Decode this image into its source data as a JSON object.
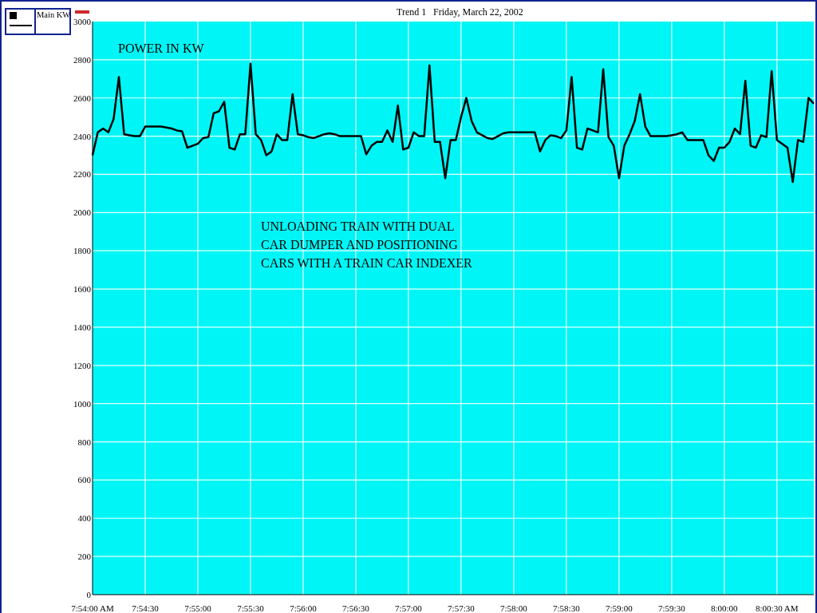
{
  "header": {
    "title": "Trend 1",
    "date": "Friday, March 22, 2002"
  },
  "chart": {
    "chart_data": {
      "type": "line",
      "grid": true,
      "ylim": [
        0,
        3000
      ],
      "yticks": [
        0,
        200,
        400,
        600,
        800,
        1000,
        1200,
        1400,
        1600,
        1800,
        2000,
        2200,
        2400,
        2600,
        2800,
        3000
      ],
      "categories": [
        "7:54:00 AM",
        null,
        null,
        null,
        null,
        null,
        null,
        null,
        null,
        null,
        "7:54:30",
        null,
        null,
        null,
        null,
        null,
        null,
        null,
        null,
        null,
        "7:55:00",
        null,
        null,
        null,
        null,
        null,
        null,
        null,
        null,
        null,
        "7:55:30",
        null,
        null,
        null,
        null,
        null,
        null,
        null,
        null,
        null,
        "7:56:00",
        null,
        null,
        null,
        null,
        null,
        null,
        null,
        null,
        null,
        "7:56:30",
        null,
        null,
        null,
        null,
        null,
        null,
        null,
        null,
        null,
        "7:57:00",
        null,
        null,
        null,
        null,
        null,
        null,
        null,
        null,
        null,
        "7:57:30",
        null,
        null,
        null,
        null,
        null,
        null,
        null,
        null,
        null,
        "7:58:00",
        null,
        null,
        null,
        null,
        null,
        null,
        null,
        null,
        null,
        "7:58:30",
        null,
        null,
        null,
        null,
        null,
        null,
        null,
        null,
        null,
        "7:59:00",
        null,
        null,
        null,
        null,
        null,
        null,
        null,
        null,
        null,
        "7:59:30",
        null,
        null,
        null,
        null,
        null,
        null,
        null,
        null,
        null,
        "8:00:00",
        null,
        null,
        null,
        null,
        null,
        null,
        null,
        null,
        null,
        "8:00:30 AM",
        null,
        null,
        null,
        null,
        null,
        null,
        null
      ],
      "series": [
        {
          "name": "Main KW",
          "color": "#000000",
          "values": [
            2300,
            2420,
            2440,
            2420,
            2490,
            2710,
            2410,
            2405,
            2400,
            2400,
            2450,
            2450,
            2450,
            2450,
            2445,
            2440,
            2430,
            2425,
            2340,
            2350,
            2360,
            2390,
            2395,
            2520,
            2530,
            2580,
            2340,
            2330,
            2410,
            2410,
            2780,
            2410,
            2380,
            2300,
            2320,
            2410,
            2380,
            2380,
            2620,
            2410,
            2405,
            2395,
            2390,
            2400,
            2410,
            2415,
            2410,
            2400,
            2400,
            2400,
            2400,
            2400,
            2305,
            2350,
            2370,
            2370,
            2430,
            2370,
            2560,
            2330,
            2340,
            2420,
            2400,
            2400,
            2770,
            2370,
            2370,
            2180,
            2380,
            2380,
            2500,
            2600,
            2480,
            2420,
            2405,
            2390,
            2385,
            2400,
            2415,
            2420,
            2420,
            2420,
            2420,
            2420,
            2420,
            2320,
            2380,
            2405,
            2400,
            2390,
            2430,
            2710,
            2340,
            2330,
            2440,
            2430,
            2420,
            2750,
            2395,
            2350,
            2180,
            2350,
            2410,
            2480,
            2620,
            2450,
            2400,
            2400,
            2400,
            2400,
            2405,
            2410,
            2420,
            2380,
            2380,
            2380,
            2380,
            2300,
            2270,
            2340,
            2340,
            2370,
            2440,
            2410,
            2690,
            2350,
            2340,
            2405,
            2395,
            2740,
            2380,
            2360,
            2340,
            2160,
            2380,
            2370,
            2600,
            2570
          ]
        }
      ],
      "annotations": [
        "POWER IN KW",
        "UNLOADING TRAIN WITH DUAL\nCAR DUMPER AND POSITIONING\nCARS WITH A TRAIN CAR INDEXER"
      ]
    }
  }
}
